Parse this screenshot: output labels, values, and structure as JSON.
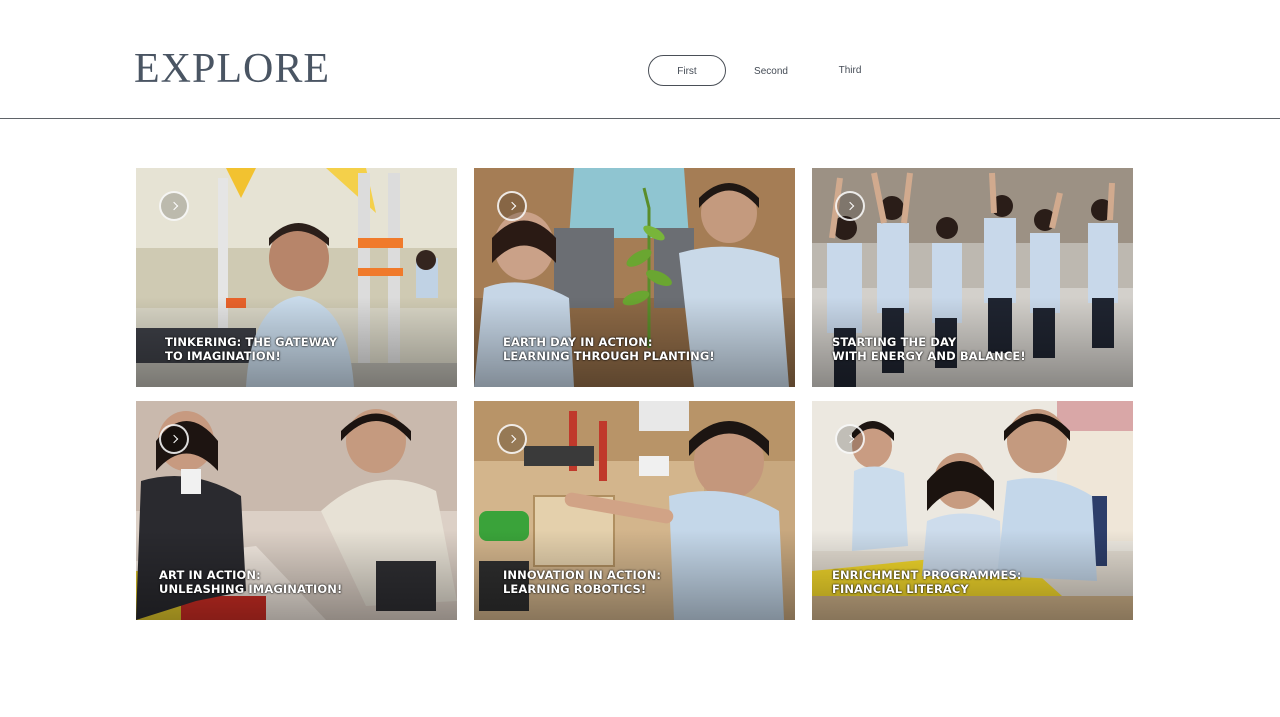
{
  "header": {
    "title": "EXPLORE",
    "tabs": [
      {
        "label": "First",
        "active": true
      },
      {
        "label": "Second",
        "active": false
      },
      {
        "label": "Third",
        "active": false
      }
    ]
  },
  "colors": {
    "title": "#4a5563",
    "divider": "#5f6368",
    "caption": "#ffffff"
  },
  "cards": [
    {
      "line1": "TINKERING: THE GATEWAY",
      "line2": "TO IMAGINATION!",
      "icon": "chevron-right-circle-icon"
    },
    {
      "line1": "EARTH DAY IN ACTION:",
      "line2": "LEARNING THROUGH PLANTING!",
      "icon": "chevron-right-circle-icon"
    },
    {
      "line1": "STARTING THE DAY",
      "line2": "WITH ENERGY AND BALANCE!",
      "icon": "chevron-right-circle-icon"
    },
    {
      "line1": "ART IN ACTION:",
      "line2": "UNLEASHING IMAGINATION!",
      "icon": "chevron-right-circle-icon"
    },
    {
      "line1": "INNOVATION IN ACTION:",
      "line2": "LEARNING ROBOTICS!",
      "icon": "chevron-right-circle-icon"
    },
    {
      "line1": "ENRICHMENT PROGRAMMES:",
      "line2": "FINANCIAL LITERACY",
      "icon": "chevron-right-circle-icon"
    }
  ]
}
